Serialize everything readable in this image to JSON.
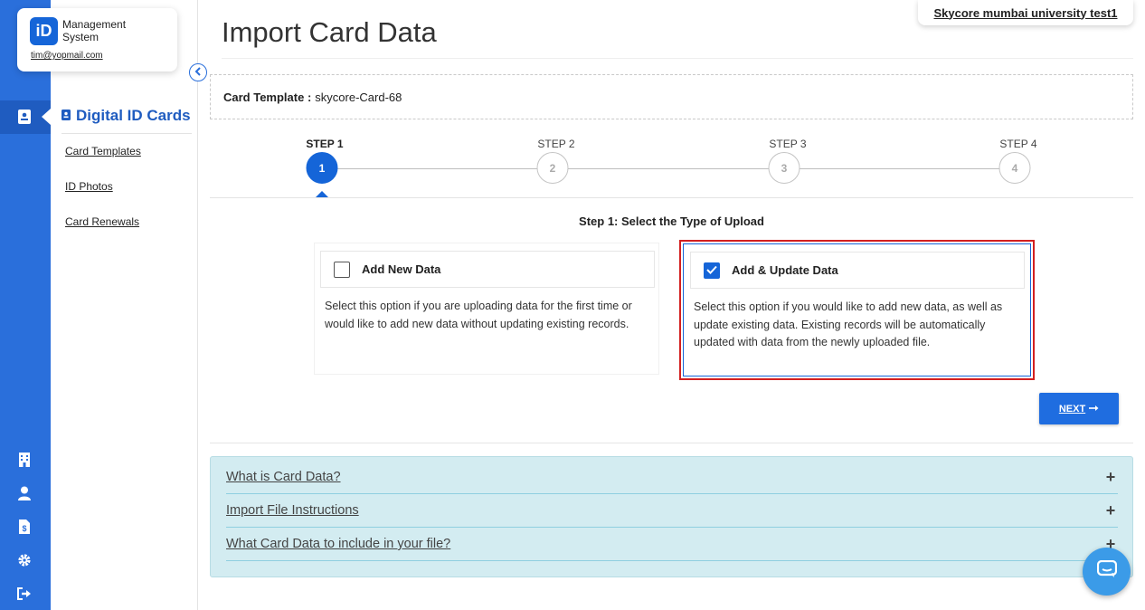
{
  "brand": {
    "logo_text": "iD",
    "name_line1": "Management",
    "name_line2": "System",
    "email": "tim@yopmail.com"
  },
  "tenant": "Skycore mumbai university test1",
  "sidebar": {
    "title": "Digital ID Cards",
    "links": [
      "Card Templates",
      "ID Photos",
      "Card Renewals"
    ]
  },
  "rail_icons": [
    "id-card-icon",
    "building-icon",
    "user-icon",
    "invoice-icon",
    "gear-icon",
    "logout-icon"
  ],
  "page": {
    "title": "Import Card Data",
    "template_label": "Card Template :",
    "template_value": "skycore-Card-68"
  },
  "steps": [
    {
      "label": "STEP 1",
      "number": "1",
      "active": true
    },
    {
      "label": "STEP 2",
      "number": "2",
      "active": false
    },
    {
      "label": "STEP 3",
      "number": "3",
      "active": false
    },
    {
      "label": "STEP 4",
      "number": "4",
      "active": false
    }
  ],
  "step1": {
    "heading": "Step 1: Select the Type of Upload",
    "options": [
      {
        "title": "Add New Data",
        "checked": false,
        "description": "Select this option if you are uploading data for the first time or would like to add new data without updating existing records."
      },
      {
        "title": "Add & Update Data",
        "checked": true,
        "description": "Select this option if you would like to add new data, as well as update existing data. Existing records will be automatically updated with data from the newly uploaded file."
      }
    ]
  },
  "next_button": "NEXT",
  "accordion": [
    {
      "label": "What is Card Data?",
      "icon": "+"
    },
    {
      "label": "Import File Instructions",
      "icon": "+"
    },
    {
      "label": "What Card Data to include in your file?",
      "icon": "+"
    }
  ],
  "colors": {
    "primary": "#2a6fdb",
    "accent": "#1565d8",
    "highlight": "#d32020",
    "accordion_bg": "#d3ecf1"
  }
}
